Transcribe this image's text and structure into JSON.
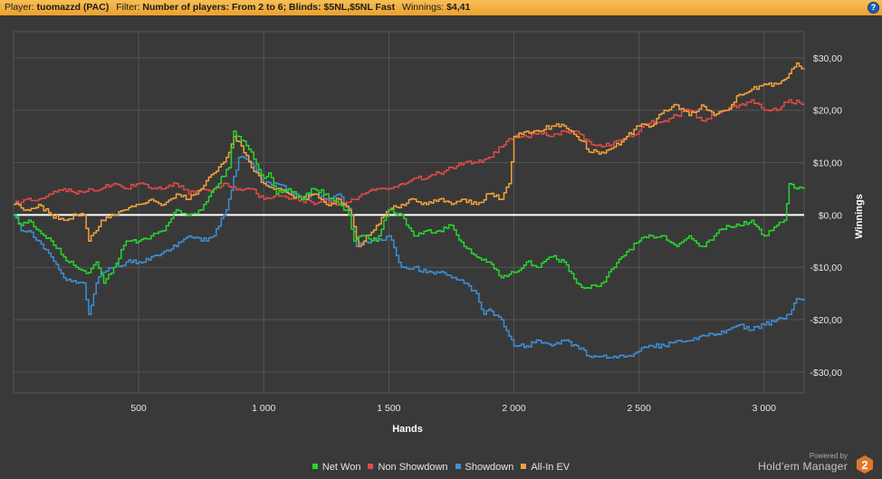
{
  "header": {
    "player_label": "Player:",
    "player_value": "tuomazzd (PAC)",
    "filter_label": "Filter:",
    "filter_value": "Number of players: From 2 to 6; Blinds: $5NL,$5NL Fast",
    "winnings_label": "Winnings:",
    "winnings_value": "$4,41",
    "help_icon": "?"
  },
  "brand": {
    "powered": "Powered by",
    "name": "Hold'em Manager",
    "logo_text": "2"
  },
  "colors": {
    "background": "#393939",
    "grid": "#555555",
    "zero_line": "#ffffff",
    "header": "#f2b040",
    "brand_logo": "#e0772a"
  },
  "chart_data": {
    "type": "line",
    "xlabel": "Hands",
    "ylabel": "Winnings",
    "xlim": [
      0,
      3160
    ],
    "ylim": [
      -34,
      35
    ],
    "xticks": [
      500,
      1000,
      1500,
      2000,
      2500,
      3000
    ],
    "xtick_labels": [
      "500",
      "1 000",
      "1 500",
      "2 000",
      "2 500",
      "3 000"
    ],
    "yticks": [
      -30,
      -20,
      -10,
      0,
      10,
      20,
      30
    ],
    "ytick_labels": [
      "-$30,00",
      "-$20,00",
      "-$10,00",
      "$0,00",
      "$10,00",
      "$20,00",
      "$30,00"
    ],
    "y_axis_side": "right",
    "grid": true,
    "zero_line": true,
    "legend_position": "bottom-center",
    "series": [
      {
        "name": "Net Won",
        "color": "#25d62c",
        "x": [
          0,
          30,
          60,
          100,
          150,
          200,
          250,
          300,
          330,
          360,
          400,
          450,
          500,
          550,
          600,
          650,
          700,
          750,
          800,
          860,
          880,
          900,
          950,
          1000,
          1020,
          1050,
          1100,
          1150,
          1200,
          1250,
          1300,
          1340,
          1360,
          1400,
          1450,
          1480,
          1500,
          1550,
          1600,
          1650,
          1700,
          1750,
          1800,
          1850,
          1900,
          1950,
          2000,
          2050,
          2100,
          2150,
          2200,
          2250,
          2280,
          2300,
          2350,
          2400,
          2450,
          2500,
          2550,
          2600,
          2650,
          2700,
          2750,
          2800,
          2850,
          2900,
          2950,
          3000,
          3050,
          3080,
          3100,
          3130,
          3160
        ],
        "values": [
          0,
          -2,
          -1,
          -3,
          -5,
          -8,
          -10,
          -11,
          -9,
          -13,
          -10,
          -5,
          -5,
          -4,
          -3,
          1,
          0,
          1,
          5,
          9,
          16,
          15,
          12,
          7,
          8,
          4,
          5,
          3,
          5,
          4,
          2,
          0,
          -5,
          -4,
          -5,
          -1,
          1,
          0,
          -4,
          -3,
          -3,
          -2,
          -6,
          -8,
          -9,
          -12,
          -11,
          -9,
          -10,
          -8,
          -9,
          -13,
          -14,
          -14,
          -13,
          -10,
          -7,
          -5,
          -4,
          -4,
          -6,
          -4,
          -6,
          -4,
          -2,
          -2,
          -1,
          -4,
          -2,
          -1,
          6,
          5,
          5
        ]
      },
      {
        "name": "Non Showdown",
        "color": "#e04a4a",
        "x": [
          0,
          50,
          100,
          150,
          200,
          250,
          300,
          350,
          400,
          450,
          500,
          550,
          600,
          650,
          700,
          750,
          800,
          850,
          900,
          950,
          1000,
          1050,
          1100,
          1150,
          1200,
          1250,
          1300,
          1350,
          1400,
          1450,
          1500,
          1550,
          1600,
          1650,
          1700,
          1750,
          1800,
          1850,
          1900,
          1950,
          2000,
          2050,
          2100,
          2150,
          2200,
          2250,
          2300,
          2350,
          2400,
          2450,
          2500,
          2550,
          2600,
          2650,
          2700,
          2750,
          2800,
          2850,
          2900,
          2950,
          3000,
          3050,
          3100,
          3160
        ],
        "values": [
          2,
          3,
          3,
          4,
          5,
          4,
          5,
          5,
          6,
          5,
          6,
          5,
          5,
          6,
          4,
          5,
          5,
          6,
          5,
          5,
          3,
          4,
          3,
          3,
          2,
          3,
          2,
          3,
          4,
          5,
          5,
          6,
          7,
          7,
          8,
          9,
          10,
          10,
          11,
          13,
          15,
          15,
          16,
          15,
          16,
          16,
          14,
          13,
          14,
          15,
          16,
          18,
          18,
          19,
          20,
          18,
          19,
          20,
          21,
          22,
          20,
          20,
          22,
          21
        ]
      },
      {
        "name": "Showdown",
        "color": "#3c8fd8",
        "x": [
          0,
          30,
          60,
          100,
          150,
          200,
          250,
          280,
          300,
          330,
          350,
          400,
          450,
          500,
          550,
          600,
          650,
          700,
          750,
          800,
          850,
          900,
          950,
          1000,
          1050,
          1100,
          1150,
          1200,
          1250,
          1300,
          1350,
          1370,
          1400,
          1450,
          1500,
          1550,
          1600,
          1650,
          1700,
          1750,
          1800,
          1850,
          1880,
          1900,
          1950,
          2000,
          2050,
          2100,
          2150,
          2200,
          2250,
          2300,
          2350,
          2400,
          2450,
          2500,
          2550,
          2600,
          2650,
          2700,
          2750,
          2800,
          2850,
          2900,
          2950,
          3000,
          3050,
          3100,
          3130,
          3160
        ],
        "values": [
          0,
          -3,
          -3,
          -5,
          -8,
          -12,
          -13,
          -13,
          -19,
          -13,
          -11,
          -10,
          -9,
          -9,
          -8,
          -7,
          -6,
          -4,
          -5,
          -4,
          1,
          11,
          10,
          6,
          6,
          5,
          3,
          4,
          3,
          4,
          0,
          -6,
          -5,
          -5,
          -4,
          -10,
          -10,
          -11,
          -11,
          -12,
          -13,
          -15,
          -19,
          -18,
          -20,
          -25,
          -25,
          -24,
          -25,
          -24,
          -25,
          -27,
          -27,
          -27,
          -27,
          -26,
          -25,
          -25,
          -24,
          -24,
          -23,
          -23,
          -22,
          -21,
          -22,
          -21,
          -20,
          -19,
          -16,
          -16
        ]
      },
      {
        "name": "All-In EV",
        "color": "#f2a23a",
        "x": [
          0,
          50,
          100,
          150,
          200,
          250,
          280,
          300,
          330,
          350,
          400,
          450,
          500,
          550,
          600,
          650,
          700,
          750,
          800,
          850,
          880,
          900,
          950,
          1000,
          1050,
          1100,
          1150,
          1200,
          1250,
          1300,
          1350,
          1380,
          1400,
          1450,
          1500,
          1550,
          1600,
          1650,
          1700,
          1750,
          1800,
          1850,
          1900,
          1950,
          1980,
          2000,
          2050,
          2100,
          2150,
          2200,
          2250,
          2280,
          2300,
          2350,
          2400,
          2450,
          2500,
          2550,
          2600,
          2650,
          2700,
          2750,
          2800,
          2850,
          2900,
          2950,
          3000,
          3050,
          3100,
          3130,
          3160
        ],
        "values": [
          2,
          1,
          2,
          0,
          -1,
          0,
          0,
          -5,
          -3,
          -1,
          0,
          1,
          2,
          3,
          2,
          4,
          3,
          5,
          8,
          11,
          15,
          14,
          9,
          6,
          5,
          4,
          3,
          4,
          2,
          3,
          0,
          -6,
          -5,
          -2,
          1,
          2,
          3,
          2,
          3,
          2,
          3,
          2,
          4,
          3,
          6,
          15,
          16,
          16,
          17,
          17,
          15,
          14,
          12,
          12,
          13,
          15,
          17,
          17,
          20,
          21,
          19,
          21,
          19,
          20,
          23,
          24,
          25,
          25,
          27,
          29,
          28
        ]
      }
    ]
  }
}
